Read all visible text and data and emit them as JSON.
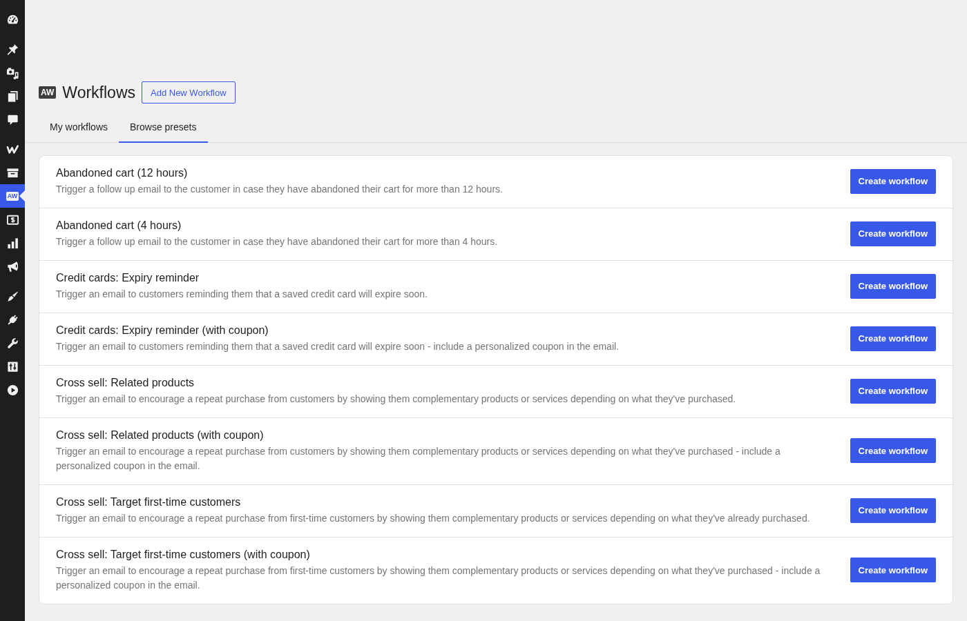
{
  "sidebar": {
    "groups": [
      {
        "items": [
          {
            "selected": false
          }
        ]
      },
      {
        "items": [
          {
            "selected": false
          },
          {
            "selected": false
          },
          {
            "selected": false
          },
          {
            "selected": false
          }
        ]
      },
      {
        "items": [
          {
            "selected": false
          },
          {
            "selected": false
          },
          {
            "selected": true,
            "logo": "AW"
          },
          {
            "selected": false
          },
          {
            "selected": false
          },
          {
            "selected": false
          }
        ]
      },
      {
        "items": [
          {
            "selected": false
          },
          {
            "selected": false
          },
          {
            "selected": false
          },
          {
            "selected": false
          },
          {
            "selected": false
          }
        ]
      }
    ]
  },
  "header": {
    "logo": "AW",
    "title": "Workflows",
    "add_button": "Add New Workflow"
  },
  "tabs": [
    {
      "label": "My workflows",
      "selected": false
    },
    {
      "label": "Browse presets",
      "selected": true
    }
  ],
  "presets": [
    {
      "title": "Abandoned cart (12 hours)",
      "description": "Trigger a follow up email to the customer in case they have abandoned their cart for more than 12 hours.",
      "button": "Create workflow"
    },
    {
      "title": "Abandoned cart (4 hours)",
      "description": "Trigger a follow up email to the customer in case they have abandoned their cart for more than 4 hours.",
      "button": "Create workflow"
    },
    {
      "title": "Credit cards: Expiry reminder",
      "description": "Trigger an email to customers reminding them that a saved credit card will expire soon.",
      "button": "Create workflow"
    },
    {
      "title": "Credit cards: Expiry reminder (with coupon)",
      "description": "Trigger an email to customers reminding them that a saved credit card will expire soon - include a personalized coupon in the email.",
      "button": "Create workflow"
    },
    {
      "title": "Cross sell: Related products",
      "description": "Trigger an email to encourage a repeat purchase from customers by showing them complementary products or services depending on what they've purchased.",
      "button": "Create workflow"
    },
    {
      "title": "Cross sell: Related products (with coupon)",
      "description": "Trigger an email to encourage a repeat purchase from customers by showing them complementary products or services depending on what they've purchased - include a personalized coupon in the email.",
      "button": "Create workflow"
    },
    {
      "title": "Cross sell: Target first-time customers",
      "description": "Trigger an email to encourage a repeat purchase from first-time customers by showing them complementary products or services depending on what they've already purchased.",
      "button": "Create workflow"
    },
    {
      "title": "Cross sell: Target first-time customers (with coupon)",
      "description": "Trigger an email to encourage a repeat purchase from first-time customers by showing them complementary products or services depending on what they've purchased - include a personalized coupon in the email.",
      "button": "Create workflow"
    }
  ]
}
